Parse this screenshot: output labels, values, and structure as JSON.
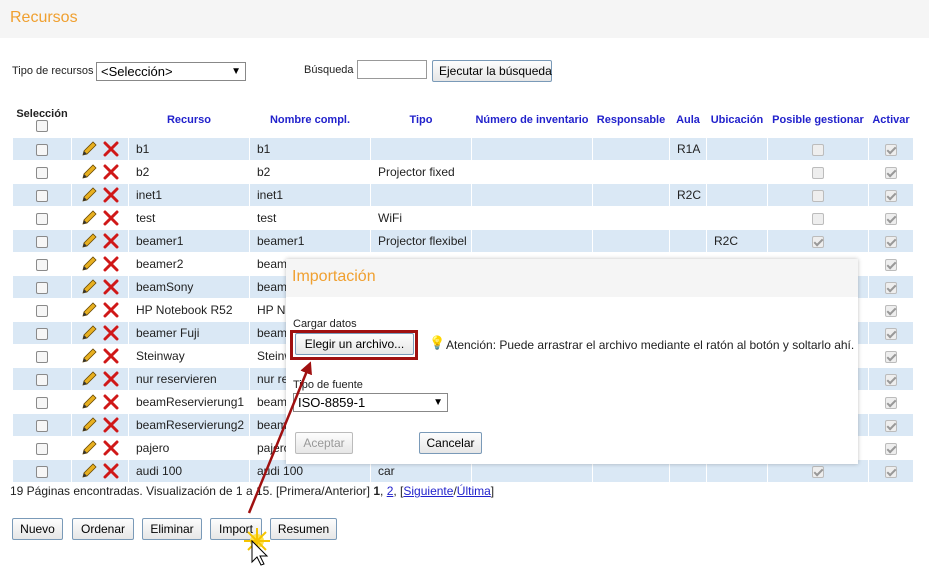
{
  "page": {
    "title": "Recursos"
  },
  "filters": {
    "type_label": "Tipo de recursos",
    "type_value": "<Selección>",
    "search_label": "Búsqueda",
    "search_value": "",
    "search_button": "Ejecutar la búsqueda"
  },
  "table": {
    "headers": [
      "Selección",
      "Recurso",
      "Nombre compl.",
      "Tipo",
      "Número de inventario",
      "Responsable",
      "Aula",
      "Ubicación",
      "Posible gestionar",
      "Activar"
    ],
    "rows": [
      {
        "recurso": "b1",
        "nombre": "b1",
        "tipo": "",
        "aula": "R1A",
        "ubicacion": "",
        "gestionar": false,
        "gestionar_disabled": true,
        "activar": true
      },
      {
        "recurso": "b2",
        "nombre": "b2",
        "tipo": "Projector fixed",
        "aula": "",
        "ubicacion": "",
        "gestionar": false,
        "gestionar_disabled": true,
        "activar": true
      },
      {
        "recurso": "inet1",
        "nombre": "inet1",
        "tipo": "",
        "aula": "R2C",
        "ubicacion": "",
        "gestionar": false,
        "gestionar_disabled": true,
        "activar": true
      },
      {
        "recurso": "test",
        "nombre": "test",
        "tipo": "WiFi",
        "aula": "",
        "ubicacion": "",
        "gestionar": false,
        "gestionar_disabled": true,
        "activar": true
      },
      {
        "recurso": "beamer1",
        "nombre": "beamer1",
        "tipo": "Projector flexibel",
        "aula": "",
        "ubicacion": "R2C",
        "gestionar": true,
        "gestionar_disabled": true,
        "activar": true
      },
      {
        "recurso": "beamer2",
        "nombre": "beame",
        "tipo": "",
        "aula": "",
        "ubicacion": "",
        "gestionar": false,
        "gestionar_disabled": true,
        "activar": true
      },
      {
        "recurso": "beamSony",
        "nombre": "beamS",
        "tipo": "",
        "aula": "",
        "ubicacion": "",
        "gestionar": false,
        "gestionar_disabled": true,
        "activar": true
      },
      {
        "recurso": "HP Notebook R52",
        "nombre": "HP No",
        "tipo": "",
        "aula": "",
        "ubicacion": "",
        "gestionar": false,
        "gestionar_disabled": true,
        "activar": true
      },
      {
        "recurso": "beamer Fuji",
        "nombre": "beame",
        "tipo": "",
        "aula": "",
        "ubicacion": "",
        "gestionar": false,
        "gestionar_disabled": true,
        "activar": true
      },
      {
        "recurso": "Steinway",
        "nombre": "Steinw",
        "tipo": "",
        "aula": "",
        "ubicacion": "",
        "gestionar": false,
        "gestionar_disabled": true,
        "activar": true
      },
      {
        "recurso": "nur reservieren",
        "nombre": "nur res",
        "tipo": "",
        "aula": "",
        "ubicacion": "",
        "gestionar": false,
        "gestionar_disabled": true,
        "activar": true
      },
      {
        "recurso": "beamReservierung1",
        "nombre": "beamF",
        "tipo": "",
        "aula": "",
        "ubicacion": "",
        "gestionar": false,
        "gestionar_disabled": true,
        "activar": true
      },
      {
        "recurso": "beamReservierung2",
        "nombre": "beam",
        "tipo": "",
        "aula": "",
        "ubicacion": "",
        "gestionar": false,
        "gestionar_disabled": true,
        "activar": true
      },
      {
        "recurso": "pajero",
        "nombre": "pajero",
        "tipo": "",
        "aula": "",
        "ubicacion": "",
        "gestionar": false,
        "gestionar_disabled": true,
        "activar": true
      },
      {
        "recurso": "audi 100",
        "nombre": "audi 100",
        "tipo": "car",
        "aula": "",
        "ubicacion": "",
        "gestionar": true,
        "gestionar_disabled": true,
        "activar": true
      }
    ]
  },
  "pager": {
    "text": "19 Páginas encontradas. Visualización de 1 a 15. [Primera/Anterior] ",
    "current": "1",
    "sep": ", ",
    "page2": "2",
    "next": "Siguiente",
    "slash": "/",
    "last": "Última",
    "open": "[",
    "close": "]"
  },
  "actions": [
    "Nuevo",
    "Ordenar",
    "Eliminar",
    "Import",
    "Resumen"
  ],
  "dialog": {
    "title": "Importación",
    "load_label": "Cargar datos",
    "choose_button": "Elegir un archivo...",
    "hint": "Atención: Puede arrastrar el archivo mediante el ratón al botón y soltarlo ahí.",
    "source_label": "Tipo de fuente",
    "source_value": "ISO-8859-1",
    "accept_button": "Aceptar",
    "cancel_button": "Cancelar"
  },
  "colors": {
    "accent": "#f0a030",
    "header_link": "#2222cc",
    "row_alt": "#dae8f5",
    "highlight": "#a01010"
  }
}
